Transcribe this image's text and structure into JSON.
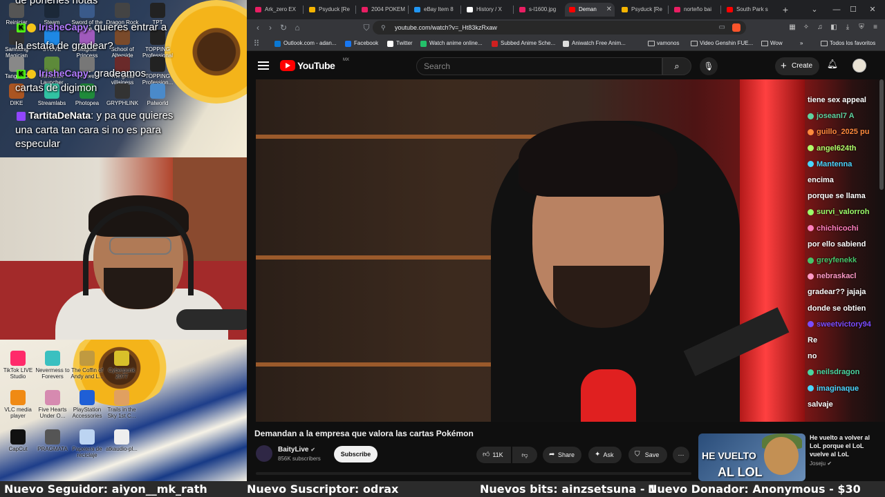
{
  "stream_overlay": {
    "chat": [
      {
        "name": "",
        "text": "de ponerles notas"
      },
      {
        "name": "IrisheCapy",
        "text": ": quieres entrar a"
      },
      {
        "name": "",
        "text": "la estafa de gradear?"
      },
      {
        "name": "IrisheCapy",
        "text": ": gradeamos"
      },
      {
        "name": "",
        "text": "cartas de digimon"
      },
      {
        "name": "TartitaDeNata",
        "text": ": y pa que quieres"
      },
      {
        "name": "",
        "text": "una carta tan cara si no es para"
      },
      {
        "name": "",
        "text": "especular"
      }
    ],
    "desktop_icons_top": [
      {
        "label": "Reiniciar"
      },
      {
        "label": "Steam"
      },
      {
        "label": "Sword of the Sea"
      },
      {
        "label": "Dragon Rock"
      },
      {
        "label": "TPT"
      },
      {
        "label": "Samsung Magician"
      },
      {
        "label": "STOVE"
      },
      {
        "label": "Magical Princess"
      },
      {
        "label": "School of Alterside"
      },
      {
        "label": "TOPPING Professional"
      },
      {
        "label": "Tangy TD"
      },
      {
        "label": "Minecraft Launcher"
      },
      {
        "label": "conve"
      },
      {
        "label": "The great villainess"
      },
      {
        "label": "TOPPING Profession..."
      },
      {
        "label": "DIKE"
      },
      {
        "label": "Streamlabs"
      },
      {
        "label": "Photopea"
      },
      {
        "label": "GRYPHLINK"
      },
      {
        "label": "Palworld"
      }
    ],
    "desktop_icons_bottom": [
      {
        "label": "TikTok LIVE Studio",
        "color": "#ff2a6a"
      },
      {
        "label": "Nevermess to Forevers",
        "color": "#3ac0c0"
      },
      {
        "label": "The Coffin of Andy and L...",
        "color": "#c09a40"
      },
      {
        "label": "Cyberpunk 2077",
        "color": "#d8c02a"
      },
      {
        "label": "VLC media player",
        "color": "#f08a14"
      },
      {
        "label": "Five Hearts Under O...",
        "color": "#d68ab0"
      },
      {
        "label": "PlayStation Accessories",
        "color": "#1f5fd6"
      },
      {
        "label": "Trails in the Sky 1st C...",
        "color": "#e0a060"
      },
      {
        "label": "CapCut",
        "color": "#111111"
      },
      {
        "label": "PRAGMATA",
        "color": "#555555"
      },
      {
        "label": "Papelera de reciclaje",
        "color": "#bcd4f2"
      },
      {
        "label": "atkaudio-pl...",
        "color": "#eeeeee"
      }
    ]
  },
  "browser": {
    "tabs": [
      {
        "label": "Ark_zero EX",
        "color": "#e91e63",
        "active": false
      },
      {
        "label": "Psyduck [Re",
        "color": "#f5b400",
        "active": false
      },
      {
        "label": "2004 POKEM",
        "color": "#e91e63",
        "active": false
      },
      {
        "label": "eBay Item 8",
        "color": "#2196f3",
        "active": false
      },
      {
        "label": "History / X",
        "color": "#ffffff",
        "active": false
      },
      {
        "label": "s-l1600.jpg",
        "color": "#e91e63",
        "active": false
      },
      {
        "label": "Deman",
        "color": "#ff0000",
        "active": true
      },
      {
        "label": "Psyduck [Re",
        "color": "#f5b400",
        "active": false
      },
      {
        "label": "norteño bai",
        "color": "#e91e63",
        "active": false
      },
      {
        "label": "South Park s",
        "color": "#ff0000",
        "active": false
      }
    ],
    "new_tab_label": "+",
    "url": "youtube.com/watch?v=_Ht83kzRxaw",
    "bookmarks": [
      {
        "label": "Outlook.com - adan...",
        "color": "#0a78d4"
      },
      {
        "label": "Facebook",
        "color": "#1877f2"
      },
      {
        "label": "Twitter",
        "color": "#ffffff"
      },
      {
        "label": "Watch anime online...",
        "color": "#24c16a"
      },
      {
        "label": "Subbed Anime Sche...",
        "color": "#d02020"
      },
      {
        "label": "Aniwatch Free Anim...",
        "color": "#dddddd"
      },
      {
        "label": "vamonos",
        "color": "folder"
      },
      {
        "label": "Video Genshin FUE...",
        "color": "folder"
      },
      {
        "label": "Wow",
        "color": "folder"
      }
    ],
    "more_bookmarks": "»",
    "all_bookmarks": "Todos los favoritos"
  },
  "youtube": {
    "logo_text": "YouTube",
    "region": "MX",
    "search_placeholder": "Search",
    "create_label": "Create",
    "video_title": "Demandan a la empresa que valora las cartas Pokémon",
    "channel_name": "BaityLive",
    "subscribers": "856K subscribers",
    "subscribe_label": "Subscribe",
    "likes": "11K",
    "share_label": "Share",
    "ask_label": "Ask",
    "save_label": "Save",
    "overlay_chat": [
      {
        "name": "tiene sex appeal",
        "color": "#ffffff"
      },
      {
        "name": "joseanl7  A",
        "color": "#5fd3a0"
      },
      {
        "name": "guillo_2025  pu",
        "color": "#ff8a3d"
      },
      {
        "name": "angel624th",
        "color": "#b0ff6a"
      },
      {
        "name": "Mantenna",
        "color": "#4ad6ff"
      },
      {
        "name": "encima",
        "color": "#ffffff"
      },
      {
        "name": "porque se llama",
        "color": "#ffffff"
      },
      {
        "name": "survi_valorroh",
        "color": "#9cff6a"
      },
      {
        "name": "chichicochi",
        "color": "#ff7fbf"
      },
      {
        "name": "por ello sabiend",
        "color": "#ffffff"
      },
      {
        "name": "greyfenekk",
        "color": "#46c46a"
      },
      {
        "name": "nebraskacl",
        "color": "#ff9ac7"
      },
      {
        "name": "gradear?? jajaja",
        "color": "#ffffff"
      },
      {
        "name": "donde se obtien",
        "color": "#ffffff"
      },
      {
        "name": "sweetvictory94",
        "color": "#7a4cff"
      },
      {
        "name": "Re",
        "color": "#ffffff"
      },
      {
        "name": "no",
        "color": "#ffffff"
      },
      {
        "name": "neilsdragon",
        "color": "#4ad6a0"
      },
      {
        "name": "imaginaque",
        "color": "#4ad6ff"
      },
      {
        "name": "salvaje",
        "color": "#ffffff"
      }
    ],
    "recommended": {
      "thumb_line1": "HE VUELTO",
      "thumb_line2": "AL LOL",
      "title": "He vuelto a volver al LoL porque el LoL vuelve al LoL",
      "channel": "Joseju"
    }
  },
  "ticker": {
    "follower": "Nuevo Seguidor: aiyon__mk_rath",
    "subscriber": "Nuevo Suscriptor: odrax",
    "bits": "Nuevos bits: ainzsetsuna - 1",
    "donor": "Nuevo Donador: Anonymous - $30"
  }
}
